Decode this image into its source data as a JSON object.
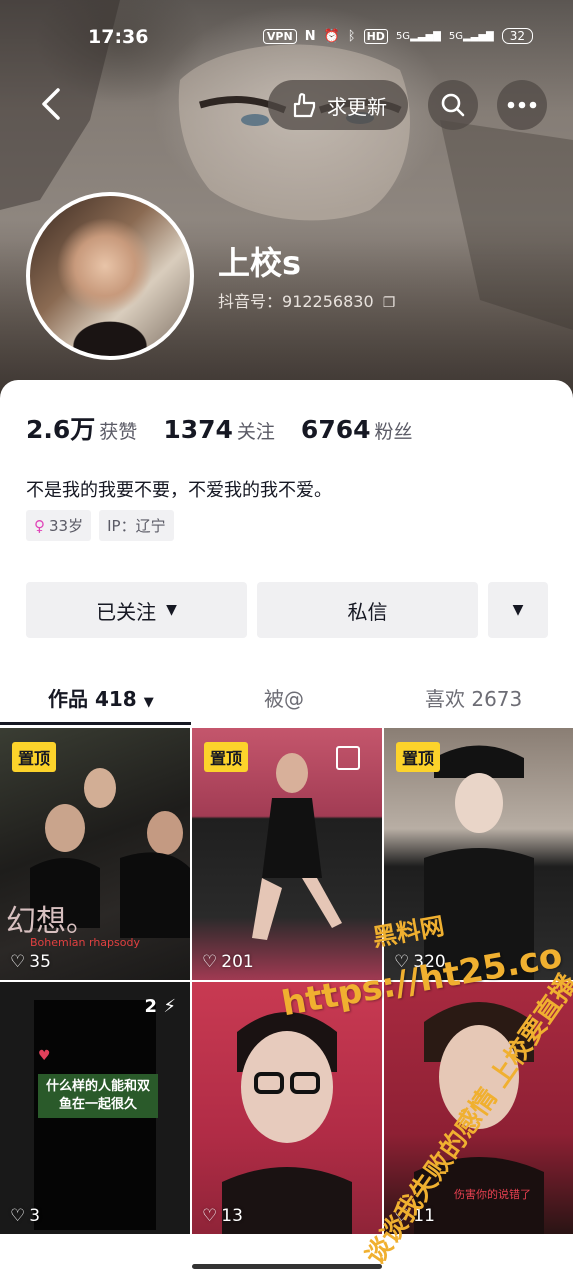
{
  "status_bar": {
    "time": "17:36",
    "vpn": "VPN",
    "hd": "HD",
    "net1": "5G",
    "net2": "5G",
    "battery": "32"
  },
  "header": {
    "request_update_label": "求更新",
    "search_icon": "search-icon",
    "more_icon": "more-icon"
  },
  "profile": {
    "name": "上校s",
    "douyin_id_label": "抖音号：",
    "douyin_id": "912256830"
  },
  "stats": [
    {
      "num": "2.6万",
      "label": "获赞"
    },
    {
      "num": "1374",
      "label": "关注"
    },
    {
      "num": "6764",
      "label": "粉丝"
    }
  ],
  "bio": "不是我的我要不要，不爱我的我不爱。",
  "tags": {
    "age": "33岁",
    "ip": "IP：辽宁"
  },
  "actions": {
    "follow_label": "已关注",
    "message_label": "私信"
  },
  "tabs": {
    "works_label": "作品 418",
    "mention_label": "被@",
    "likes_label": "喜欢 2673"
  },
  "videos": [
    {
      "pinned": "置顶",
      "likes": "35",
      "caption": "幻想。",
      "subcaption": "Bohemian rhapsody"
    },
    {
      "pinned": "置顶",
      "likes": "201"
    },
    {
      "pinned": "置顶",
      "likes": "320"
    },
    {
      "likes": "3",
      "count_badge": "2",
      "banner": "什么样的人能和双鱼在一起很久"
    },
    {
      "likes": "13"
    },
    {
      "likes": "11",
      "caption": "伤害你的说错了"
    }
  ],
  "watermark": {
    "line0": "黑料网",
    "line1": "https://ht25.co",
    "line2": "谈谈我失败的感情 上校要直播"
  },
  "colors": {
    "pin_badge": "#fcd32b",
    "accent_text": "#161823",
    "gender_icon": "#e044b8",
    "watermark": "#f0b030"
  }
}
